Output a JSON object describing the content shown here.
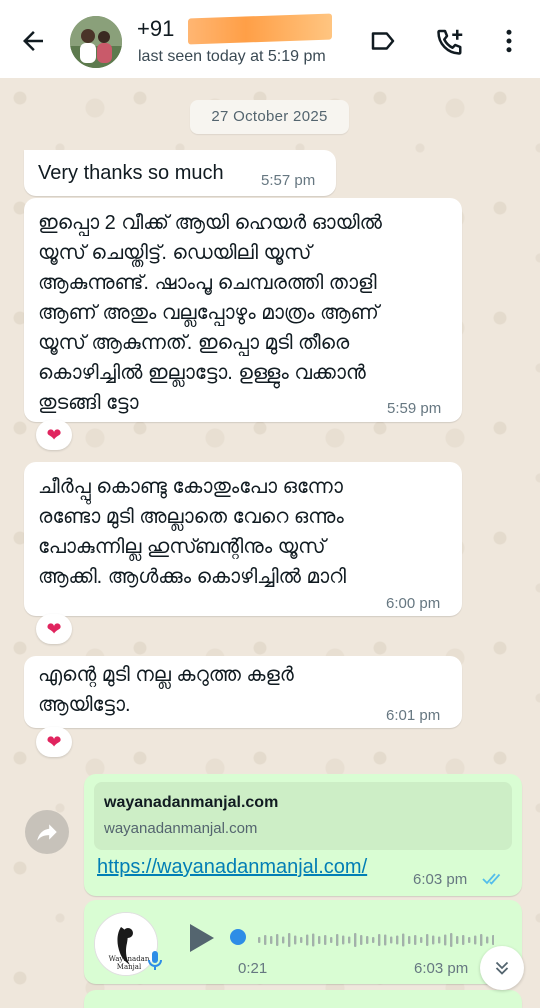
{
  "header": {
    "contact_name": "+91",
    "last_seen": "last seen today at 5:19 pm"
  },
  "date_chip": "27 October 2025",
  "messages": [
    {
      "text": "Very thanks so much",
      "time": "5:57 pm"
    },
    {
      "lines": [
        "ഇപ്പൊ 2 വീക്ക് ആയി ഹെയർ ഓയിൽ",
        "യൂസ് ചെയ്തിട്ട്. ഡെയിലി യൂസ്",
        "ആകുന്നുണ്ട്. ഷാംപൂ ചെമ്പരത്തി താളി",
        "ആണ് അതും വല്ലപ്പോഴും മാത്രം ആണ്",
        "യൂസ് ആകുന്നത്. ഇപ്പൊ മുടി തീരെ",
        "കൊഴിച്ചിൽ ഇല്ലാട്ടോ. ഉള്ളും വക്കാൻ",
        "തുടങ്ങി ട്ടോ"
      ],
      "time": "5:59 pm",
      "reaction": "❤"
    },
    {
      "lines": [
        "ചീർപ്പു കൊണ്ടു കോതുംപോ ഒന്നോ",
        "രണ്ടോ മുടി അല്ലാതെ വേറെ ഒന്നും",
        "പോകുന്നില്ല ഹുസ്ബന്റിനും യൂസ്",
        "ആക്കി. ആൾക്കും കൊഴിച്ചിൽ മാറി"
      ],
      "time": "6:00 pm",
      "reaction": "❤"
    },
    {
      "lines": [
        "എന്റെ മുടി നല്ല കറുത്ത കളർ",
        "ആയിട്ടോ."
      ],
      "time": "6:01 pm",
      "reaction": "❤"
    }
  ],
  "outgoing_link": {
    "preview_title": "wayanadanmanjal.com",
    "preview_domain": "wayanadanmanjal.com",
    "url": "https://wayanadanmanjal.com/",
    "time": "6:03 pm",
    "status": "read"
  },
  "voice_note": {
    "avatar_label_line1": "Wayanadan",
    "avatar_label_line2": "Manjal",
    "duration": "0:21",
    "time": "6:03 pm",
    "progress": 0
  },
  "colors": {
    "header_bg": "#ffffff",
    "outgoing_bubble": "#d9fdd3",
    "incoming_bubble": "#ffffff",
    "link": "#027eb5",
    "read_ticks": "#53bdeb",
    "icon_gray": "#54656f",
    "mask_orange": "#ff9a3d"
  },
  "icons": [
    "back-arrow-icon",
    "label-icon",
    "add-call-icon",
    "more-vert-icon",
    "forward-icon",
    "play-icon",
    "mic-icon",
    "double-check-icon",
    "chevrons-down-icon",
    "heart-icon"
  ]
}
